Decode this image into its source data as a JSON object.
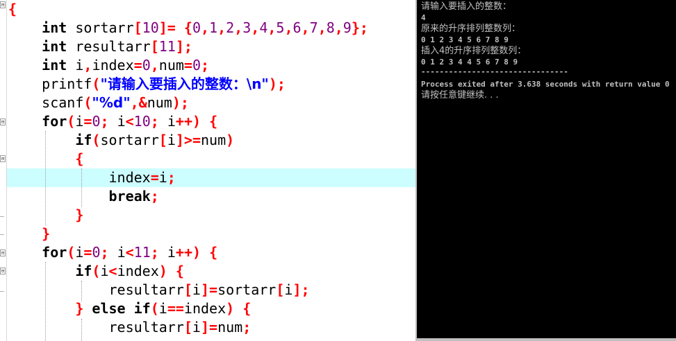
{
  "editor": {
    "lines": [
      {
        "p": [
          [
            "op",
            "{"
          ]
        ]
      },
      {
        "p": [
          [
            "t",
            "    "
          ],
          [
            "kw",
            "int"
          ],
          [
            "t",
            " sortarr"
          ],
          [
            "op",
            "["
          ],
          [
            "num",
            "10"
          ],
          [
            "op",
            "]= {"
          ],
          [
            "num",
            "0"
          ],
          [
            "op",
            ","
          ],
          [
            "num",
            "1"
          ],
          [
            "op",
            ","
          ],
          [
            "num",
            "2"
          ],
          [
            "op",
            ","
          ],
          [
            "num",
            "3"
          ],
          [
            "op",
            ","
          ],
          [
            "num",
            "4"
          ],
          [
            "op",
            ","
          ],
          [
            "num",
            "5"
          ],
          [
            "op",
            ","
          ],
          [
            "num",
            "6"
          ],
          [
            "op",
            ","
          ],
          [
            "num",
            "7"
          ],
          [
            "op",
            ","
          ],
          [
            "num",
            "8"
          ],
          [
            "op",
            ","
          ],
          [
            "num",
            "9"
          ],
          [
            "op",
            "};"
          ]
        ]
      },
      {
        "p": [
          [
            "t",
            "    "
          ],
          [
            "kw",
            "int"
          ],
          [
            "t",
            " resultarr"
          ],
          [
            "op",
            "["
          ],
          [
            "num",
            "11"
          ],
          [
            "op",
            "];"
          ]
        ]
      },
      {
        "p": [
          [
            "t",
            "    "
          ],
          [
            "kw",
            "int"
          ],
          [
            "t",
            " i"
          ],
          [
            "op",
            ","
          ],
          [
            "t",
            "index"
          ],
          [
            "op",
            "="
          ],
          [
            "num",
            "0"
          ],
          [
            "op",
            ","
          ],
          [
            "t",
            "num"
          ],
          [
            "op",
            "="
          ],
          [
            "num",
            "0"
          ],
          [
            "op",
            ";"
          ]
        ]
      },
      {
        "p": [
          [
            "t",
            "    printf"
          ],
          [
            "op",
            "("
          ],
          [
            "str",
            "\"请输入要插入的整数：\\n\""
          ],
          [
            "op",
            ");"
          ]
        ]
      },
      {
        "p": [
          [
            "t",
            "    scanf"
          ],
          [
            "op",
            "("
          ],
          [
            "str",
            "\"%d\""
          ],
          [
            "op",
            ",&"
          ],
          [
            "t",
            "num"
          ],
          [
            "op",
            ");"
          ]
        ]
      },
      {
        "p": [
          [
            "t",
            "    "
          ],
          [
            "kw",
            "for"
          ],
          [
            "op",
            "("
          ],
          [
            "t",
            "i"
          ],
          [
            "op",
            "="
          ],
          [
            "num",
            "0"
          ],
          [
            "op",
            ";"
          ],
          [
            "t",
            " i"
          ],
          [
            "op",
            "<"
          ],
          [
            "num",
            "10"
          ],
          [
            "op",
            ";"
          ],
          [
            "t",
            " i"
          ],
          [
            "op",
            "++) {"
          ]
        ]
      },
      {
        "p": [
          [
            "t",
            "        "
          ],
          [
            "kw",
            "if"
          ],
          [
            "op",
            "("
          ],
          [
            "t",
            "sortarr"
          ],
          [
            "op",
            "["
          ],
          [
            "t",
            "i"
          ],
          [
            "op",
            "]>="
          ],
          [
            "t",
            "num"
          ],
          [
            "op",
            ")"
          ]
        ]
      },
      {
        "p": [
          [
            "t",
            "        "
          ],
          [
            "op",
            "{"
          ]
        ]
      },
      {
        "p": [
          [
            "t",
            "            index"
          ],
          [
            "op",
            "="
          ],
          [
            "t",
            "i"
          ],
          [
            "op",
            ";"
          ]
        ]
      },
      {
        "p": [
          [
            "t",
            "            "
          ],
          [
            "kw",
            "break"
          ],
          [
            "op",
            ";"
          ]
        ]
      },
      {
        "p": [
          [
            "t",
            "        "
          ],
          [
            "op",
            "}"
          ]
        ]
      },
      {
        "p": [
          [
            "t",
            "    "
          ],
          [
            "op",
            "}"
          ]
        ]
      },
      {
        "p": [
          [
            "t",
            "    "
          ],
          [
            "kw",
            "for"
          ],
          [
            "op",
            "("
          ],
          [
            "t",
            "i"
          ],
          [
            "op",
            "="
          ],
          [
            "num",
            "0"
          ],
          [
            "op",
            ";"
          ],
          [
            "t",
            " i"
          ],
          [
            "op",
            "<"
          ],
          [
            "num",
            "11"
          ],
          [
            "op",
            ";"
          ],
          [
            "t",
            " i"
          ],
          [
            "op",
            "++) {"
          ]
        ]
      },
      {
        "p": [
          [
            "t",
            "        "
          ],
          [
            "kw",
            "if"
          ],
          [
            "op",
            "("
          ],
          [
            "t",
            "i"
          ],
          [
            "op",
            "<"
          ],
          [
            "t",
            "index"
          ],
          [
            "op",
            ") {"
          ]
        ]
      },
      {
        "p": [
          [
            "t",
            "            resultarr"
          ],
          [
            "op",
            "["
          ],
          [
            "t",
            "i"
          ],
          [
            "op",
            "]="
          ],
          [
            "t",
            "sortarr"
          ],
          [
            "op",
            "["
          ],
          [
            "t",
            "i"
          ],
          [
            "op",
            "];"
          ]
        ]
      },
      {
        "p": [
          [
            "t",
            "        "
          ],
          [
            "op",
            "} "
          ],
          [
            "kw",
            "else if"
          ],
          [
            "op",
            "("
          ],
          [
            "t",
            "i"
          ],
          [
            "op",
            "=="
          ],
          [
            "t",
            "index"
          ],
          [
            "op",
            ") {"
          ]
        ]
      },
      {
        "p": [
          [
            "t",
            "            resultarr"
          ],
          [
            "op",
            "["
          ],
          [
            "t",
            "i"
          ],
          [
            "op",
            "]="
          ],
          [
            "t",
            "num"
          ],
          [
            "op",
            ";"
          ]
        ]
      }
    ],
    "fold_markers": [
      "⊟",
      "⊟",
      "⊟",
      "⊟",
      "⊟"
    ]
  },
  "console": {
    "prompt": "请输入要插入的整数：",
    "input_value": "4",
    "original_label": "原来的升序排列整数列：",
    "original_values": "0 1 2 3 4 5 6 7 8 9",
    "inserted_label": "插入4的升序排列整数列：",
    "inserted_values": "0 1 2 3 4 4 5 6 7 8 9",
    "separator": "--------------------------------",
    "process_message": "Process exited after 3.638 seconds with return value 0",
    "continue_prompt": "请按任意键继续. . ."
  }
}
